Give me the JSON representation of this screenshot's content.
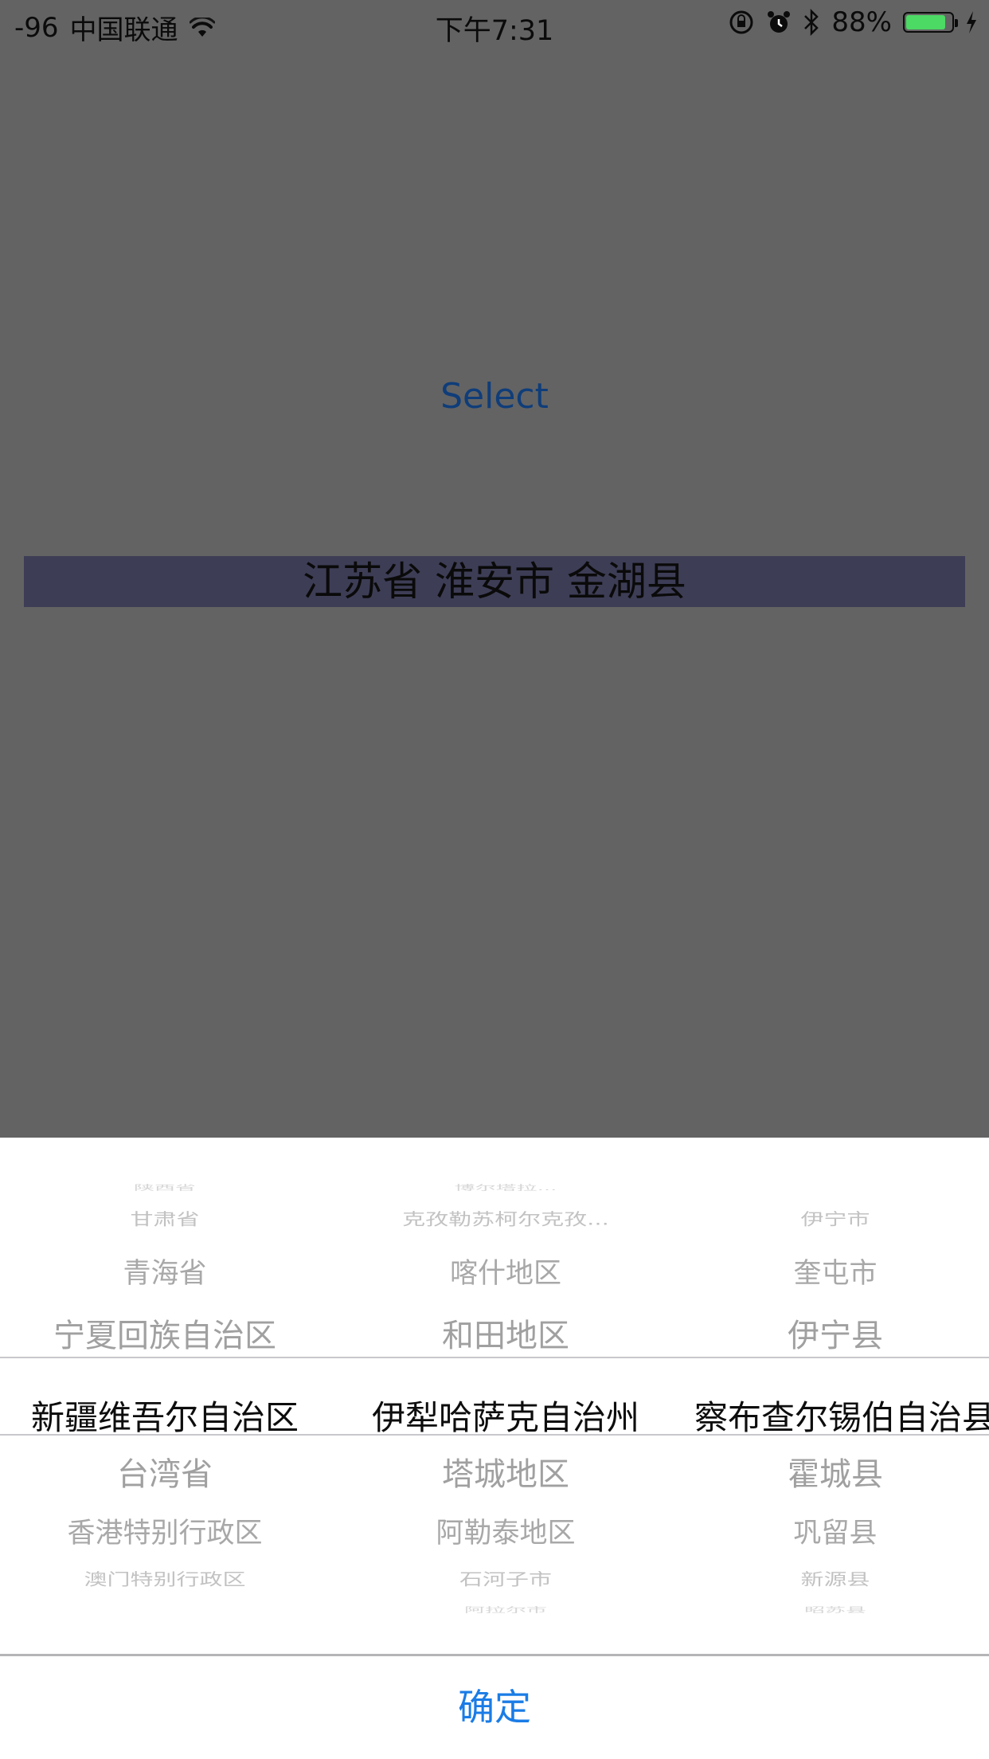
{
  "status_bar": {
    "signal": "-96",
    "carrier": "中国联通",
    "time": "下午7:31",
    "battery_percent": "88%",
    "battery_level": 0.88
  },
  "main": {
    "select_label": "Select",
    "result_text": "江苏省 淮安市 金湖县"
  },
  "picker": {
    "columns": [
      {
        "items": [
          "陕西省",
          "甘肃省",
          "青海省",
          "宁夏回族自治区",
          "新疆维吾尔自治区",
          "台湾省",
          "香港特别行政区",
          "澳门特别行政区",
          ""
        ],
        "selected": "新疆维吾尔自治区"
      },
      {
        "items": [
          "博尔塔拉...",
          "克孜勒苏柯尔克孜...",
          "喀什地区",
          "和田地区",
          "伊犁哈萨克自治州",
          "塔城地区",
          "阿勒泰地区",
          "石河子市",
          "阿拉尔市"
        ],
        "selected": "伊犁哈萨克自治州"
      },
      {
        "items": [
          "",
          "伊宁市",
          "奎屯市",
          "伊宁县",
          "察布查尔锡伯自治县",
          "霍城县",
          "巩留县",
          "新源县",
          "昭苏县"
        ],
        "selected": "察布查尔锡伯自治县"
      }
    ]
  },
  "footer": {
    "confirm_label": "确定"
  },
  "colors": {
    "overlay_bg": "#636363",
    "accent_blue": "#1a7ce6",
    "select_blue": "#0f3d7a",
    "result_bar": "#3d3d56",
    "battery_green": "#4cd964"
  }
}
